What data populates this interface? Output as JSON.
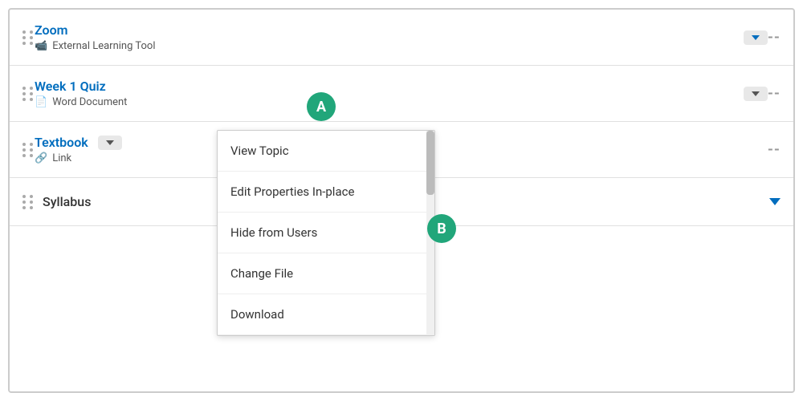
{
  "items": [
    {
      "id": "zoom",
      "title": "Zoom",
      "subtitle": "External Learning Tool",
      "subtitle_icon": "🎥",
      "has_dropdown": true,
      "dropdown_inline": true,
      "dash": "--"
    },
    {
      "id": "week1quiz",
      "title": "Week 1 Quiz",
      "subtitle": "Word Document",
      "subtitle_icon": "📄",
      "has_dropdown": true,
      "dropdown_box": true,
      "dash": "--"
    },
    {
      "id": "textbook",
      "title": "Textbook",
      "subtitle": "Link",
      "subtitle_icon": "🔗",
      "has_dropdown": true,
      "dropdown_inline": true,
      "dash": "--"
    }
  ],
  "syllabus": {
    "title": "Syllabus",
    "chevron": "▼"
  },
  "dropdown_menu": {
    "items": [
      {
        "id": "view-topic",
        "label": "View Topic"
      },
      {
        "id": "edit-properties",
        "label": "Edit Properties In-place"
      },
      {
        "id": "hide-from-users",
        "label": "Hide from Users"
      },
      {
        "id": "change-file",
        "label": "Change File"
      },
      {
        "id": "download",
        "label": "Download"
      }
    ]
  },
  "badges": {
    "a": "A",
    "b": "B"
  },
  "icons": {
    "drag": "⠿",
    "external_tool": "📹",
    "document": "📄",
    "link": "🔗"
  }
}
